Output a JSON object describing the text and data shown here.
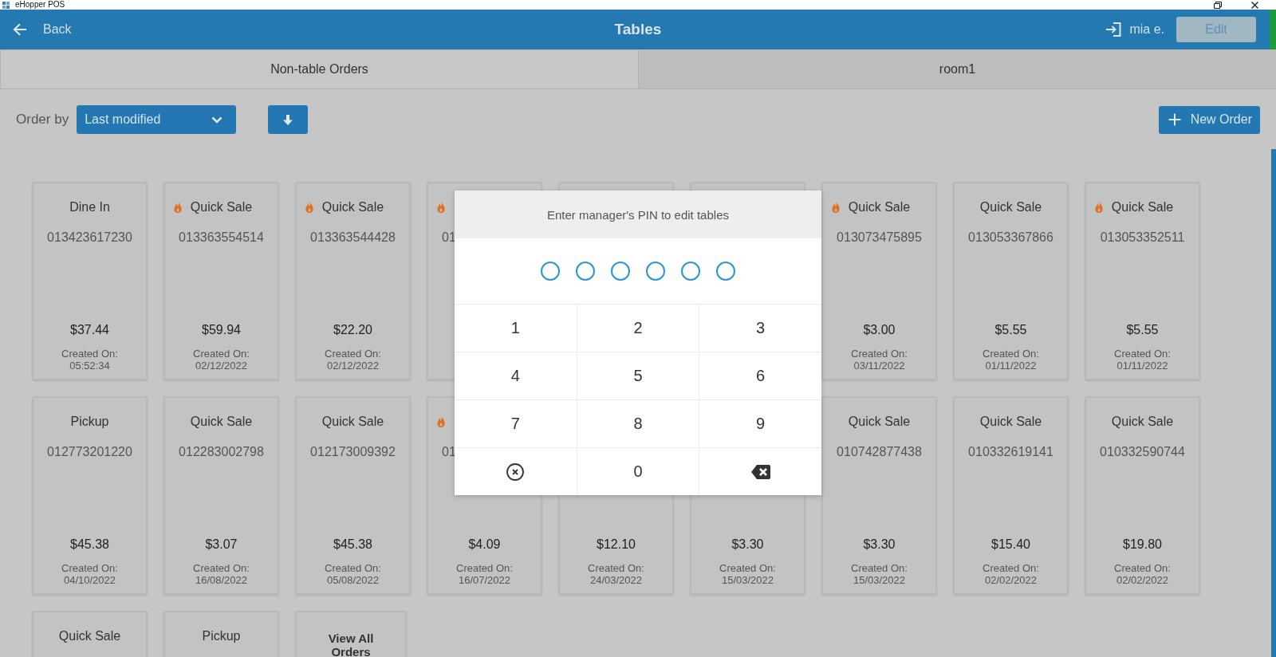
{
  "window": {
    "title": "eHopper POS"
  },
  "app_bar": {
    "back": "Back",
    "title": "Tables",
    "user": "mia e.",
    "edit": {
      "label": "Edit",
      "disabled": true
    }
  },
  "tabs": [
    {
      "label": "Non-table Orders",
      "selected": true
    },
    {
      "label": "room1",
      "selected": false
    }
  ],
  "toolbar": {
    "order_by_label": "Order by",
    "order_by": "Last modified",
    "sort_descending": true,
    "new_order": "New Order"
  },
  "orders": [
    {
      "kind": "order",
      "flame": false,
      "title": "Dine In",
      "number": "013423617230",
      "covered": false,
      "total": "$37.44",
      "created_label": "Created On:",
      "created": "05:52:34"
    },
    {
      "kind": "order",
      "flame": true,
      "title": "Quick Sale",
      "number": "013363554514",
      "covered": false,
      "total": "$59.94",
      "created_label": "Created On:",
      "created": "02/12/2022"
    },
    {
      "kind": "order",
      "flame": true,
      "title": "Quick Sale",
      "number": "013363544428",
      "covered": false,
      "total": "$22.20",
      "created_label": "Created On:",
      "created": "02/12/2022"
    },
    {
      "kind": "order",
      "flame": true,
      "number": "01",
      "covered": true
    },
    {
      "kind": "order"
    },
    {
      "kind": "order"
    },
    {
      "kind": "order",
      "flame": true,
      "title": "Quick Sale",
      "number": "013073475895",
      "covered": false,
      "total": "$3.00",
      "created_label": "Created On:",
      "created": "03/11/2022"
    },
    {
      "kind": "order",
      "flame": false,
      "title": "Quick Sale",
      "number": "013053367866",
      "covered": false,
      "total": "$5.55",
      "created_label": "Created On:",
      "created": "01/11/2022"
    },
    {
      "kind": "order",
      "flame": true,
      "title": "Quick Sale",
      "number": "013053352511",
      "covered": false,
      "total": "$5.55",
      "created_label": "Created On:",
      "created": "01/11/2022"
    },
    {
      "kind": "order",
      "flame": false,
      "title": "Pickup",
      "number": "012773201220",
      "covered": false,
      "total": "$45.38",
      "created_label": "Created On:",
      "created": "04/10/2022"
    },
    {
      "kind": "order",
      "flame": false,
      "title": "Quick Sale",
      "number": "012283002798",
      "covered": false,
      "total": "$3.07",
      "created_label": "Created On:",
      "created": "16/08/2022"
    },
    {
      "kind": "order",
      "flame": false,
      "title": "Quick Sale",
      "number": "012173009392",
      "covered": false,
      "total": "$45.38",
      "created_label": "Created On:",
      "created": "05/08/2022"
    },
    {
      "kind": "order",
      "flame": true,
      "number": "01",
      "covered": true,
      "total": "$4.09",
      "created_label": "Created On:",
      "created": "16/07/2022"
    },
    {
      "kind": "order",
      "total": "$12.10",
      "created_label": "Created On:",
      "created": "24/03/2022"
    },
    {
      "kind": "order",
      "total": "$3.30",
      "created_label": "Created On:",
      "created": "15/03/2022"
    },
    {
      "kind": "order",
      "flame": false,
      "title": "Quick Sale",
      "number": "010742877438",
      "covered": false,
      "total": "$3.30",
      "created_label": "Created On:",
      "created": "15/03/2022"
    },
    {
      "kind": "order",
      "flame": false,
      "title": "Quick Sale",
      "number": "010332619141",
      "covered": false,
      "total": "$15.40",
      "created_label": "Created On:",
      "created": "02/02/2022"
    },
    {
      "kind": "order",
      "flame": false,
      "title": "Quick Sale",
      "number": "010332590744",
      "covered": false,
      "total": "$19.80",
      "created_label": "Created On:",
      "created": "02/02/2022"
    },
    {
      "kind": "order",
      "flame": false,
      "title": "Quick Sale"
    },
    {
      "kind": "order",
      "flame": false,
      "title": "Pickup"
    },
    {
      "kind": "view_all",
      "title": "View All Orders"
    }
  ],
  "pin_dialog": {
    "prompt": "Enter manager's PIN to edit tables",
    "digits": [
      {
        "filled": false
      },
      {
        "filled": false
      },
      {
        "filled": false
      },
      {
        "filled": false
      },
      {
        "filled": false
      },
      {
        "filled": false
      }
    ],
    "keys": [
      {
        "kind": "digit",
        "label": "1"
      },
      {
        "kind": "digit",
        "label": "2"
      },
      {
        "kind": "digit",
        "label": "3"
      },
      {
        "kind": "digit",
        "label": "4"
      },
      {
        "kind": "digit",
        "label": "5"
      },
      {
        "kind": "digit",
        "label": "6"
      },
      {
        "kind": "digit",
        "label": "7"
      },
      {
        "kind": "digit",
        "label": "8"
      },
      {
        "kind": "digit",
        "label": "9"
      },
      {
        "kind": "clear"
      },
      {
        "kind": "digit",
        "label": "0"
      },
      {
        "kind": "backspace"
      }
    ]
  }
}
